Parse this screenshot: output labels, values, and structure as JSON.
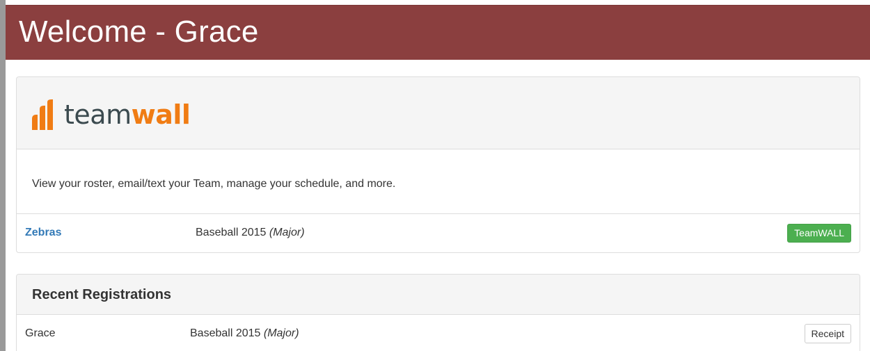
{
  "header": {
    "title": "Welcome - Grace",
    "background_color": "#8b3f3f"
  },
  "teamwall_panel": {
    "logo": {
      "word_dark": "team",
      "word_accent": "wall",
      "accent_color": "#f07c14",
      "icon": "teamwall-bars-icon"
    },
    "description": "View your roster, email/text your Team, manage your schedule, and more.",
    "teams": [
      {
        "name": "Zebras",
        "season": "Baseball 2015",
        "division": "(Major)",
        "button_label": "TeamWALL"
      }
    ]
  },
  "recent_registrations": {
    "title": "Recent Registrations",
    "rows": [
      {
        "name": "Grace",
        "season": "Baseball 2015",
        "division": "(Major)",
        "button_label": "Receipt"
      }
    ]
  },
  "colors": {
    "link": "#337ab7",
    "success": "#4caf50"
  }
}
